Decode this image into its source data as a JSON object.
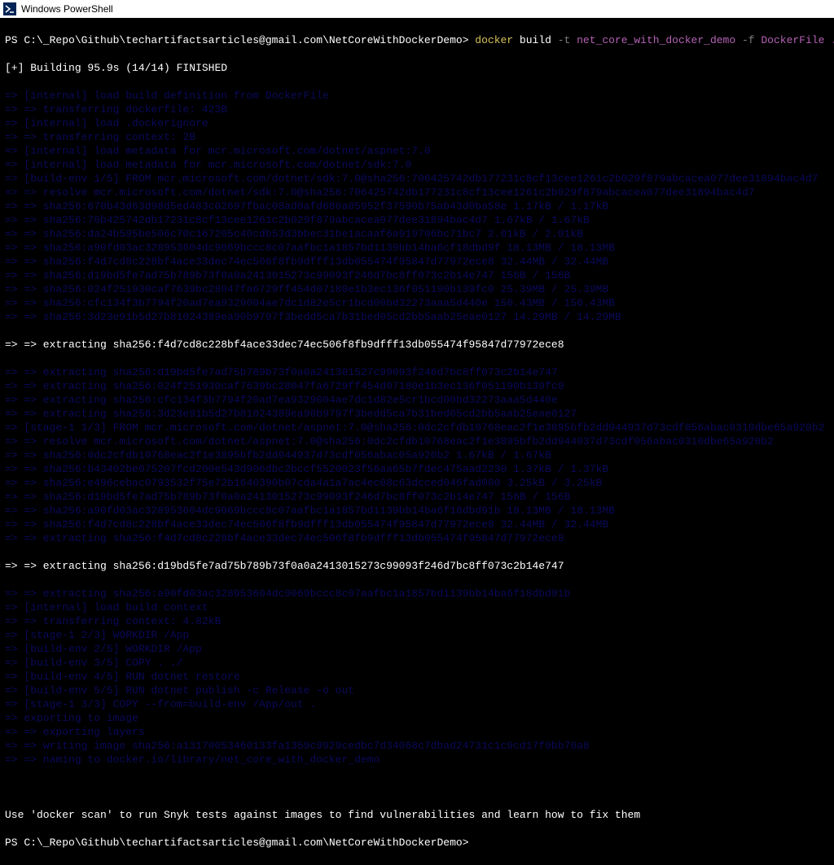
{
  "window": {
    "title": "Windows PowerShell"
  },
  "prompt": {
    "path1": "PS C:\\_Repo\\Github\\techartifactsarticles@gmail.com\\NetCoreWithDockerDemo> ",
    "cmd_docker": "docker",
    "cmd_build": " build ",
    "flag_t": "-t",
    "arg_name": " net_core_with_docker_demo ",
    "flag_f": "-f",
    "arg_file": " DockerFile .",
    "path2": "PS C:\\_Repo\\Github\\techartifactsarticles@gmail.com\\NetCoreWithDockerDemo>"
  },
  "build_header": "[+] Building 95.9s (14/14) FINISHED",
  "dim_lines_1": [
    "=> [internal] load build definition from DockerFile",
    "=> => transferring dockerfile: 423B",
    "=> [internal] load .dockerignore",
    "=> => transferring context: 2B",
    "=> [internal] load metadata for mcr.microsoft.com/dotnet/aspnet:7.0",
    "=> [internal] load metadata for mcr.microsoft.com/dotnet/sdk:7.0",
    "=> [build-env 1/5] FROM mcr.microsoft.com/dotnet/sdk:7.0@sha256:706425742db177231c8cf13cee1261c2b029f879abcacea077dee31894bac4d7",
    "=> => resolve mcr.microsoft.com/dotnet/sdk:7.0@sha256:706425742db177231c8cf13cee1261c2b029f879abcacea077dee31894bac4d7",
    "=> => sha256:670b43d63d98d5ed483c02697fbac08ad0afd680a05952f37590b75ab43d0ba58e 1.17kB / 1.17kB",
    "=> => sha256:70b425742db17231c8cf13cee1261c2b029f879abcacea077dee31894bac4d7 1.67kB / 1.67kB",
    "=> => sha256:da24b595be506c70c167205c40cdb53d3bbec31be1acaaf6a919706bc71bc7 2.01kB / 2.01kB",
    "=> => sha256:a90fd03ac328953604dc9069bccc8c07aafbc1a1857bd1139bb14ba6cf18dbd9f 18.13MB / 18.13MB",
    "=> => sha256:f4d7cd8c228bf4ace33dec74ec506f8fb9dfff13db055474f95847d77972ece8 32.44MB / 32.44MB",
    "=> => sha256:d19bd5fe7ad75b789b73f0a0a2413015273c99093f246d7bc8ff073c2b14e747 156B / 156B",
    "=> => sha256:024f251930caf7639bc28047fa6729ff454d07180e1b3ec136f051190b139fc0 25.39MB / 25.39MB",
    "=> => sha256:cfc134f3b7794f20ad7ea9329004ae7dc1d82e5cr1bcd00bd32273aaa5d440e 156.43MB / 156.43MB",
    "=> => sha256:3d23e91b5d27b81024389ea90b9797f3bedd5ca7b31bed05cd2bb5aab25eae0127 14.29MB / 14.29MB"
  ],
  "extract1": "=> => extracting sha256:f4d7cd8c228bf4ace33dec74ec506f8fb9dfff13db055474f95847d77972ece8",
  "dim_lines_2": [
    "=> => extracting sha256:d19bd5fe7ad75b789b73f0a0a241301527c99093f246d7bc8ff073c2b14e747",
    "=> => extracting sha256:024f251930caf7639bc28047fa6729ff454d07180e1b3ec136f051190b139fc0",
    "=> => extracting sha256:cfc134f3b7794f20ad7ea9329004ae7dc1d82e5cr1bcd00bd32273aaa5d440e",
    "=> => extracting sha256:3d23e91b5d27b81024389ea90b9797f3bedd5ca7b31bed05cd2bb5aab25eae0127",
    "=> [stage-1 1/3] FROM mcr.microsoft.com/dotnet/aspnet:7.0@sha256:0dc2cfdb10768eac2f1e3895bfb2dd944937d73cdf056abac0310dbe65a920b2",
    "=> => resolve mcr.microsoft.com/dotnet/aspnet:7.0@sha256:0dc2cfdb10768eac2f1e3895bfb2dd944937d73cdf056abac0310dbe65a920b2",
    "=> => sha256:0dc2cfdb10768eac2f1e3895bfb2dd944937d73cdf056abac05a920b2 1.67kB / 1.67kB",
    "=> => sha256:b43402be075207fcd200e543d906dbc2bccf5520023f56aa65b7fdec475aad2230 1.37kB / 1.37kB",
    "=> => sha256:e496cebac0793532f75e72b1640390b07cda4a1a7ac4ec08c63dcced046fad000 3.25kB / 3.25kB",
    "=> => sha256:d19bd5fe7ad75b789b73f0a0a2413015273c99093f246d7bc8ff073c2b14e747 156B / 156B",
    "=> => sha256:a90fd03ac328953604dc9069bccc8c07aafbc1a1857bd1139bb14ba6f18dbd91b 18.13MB / 18.13MB",
    "=> => sha256:f4d7cd8c228bf4ace33dec74ec506f8fb9dfff13db055474f95847d77972ece8 32.44MB / 32.44MB",
    "=> => extracting sha256:f4d7cd8c228bf4ace33dec74ec506f8fb9dfff13db055474f95847d77972ece8"
  ],
  "extract2": "=> => extracting sha256:d19bd5fe7ad75b789b73f0a0a2413015273c99093f246d7bc8ff073c2b14e747",
  "dim_lines_3": [
    "=> => extracting sha256:a90fd03ac328953604dc9069bccc8c07aafbc1a1857bd1139bb14ba6f18dbd91b",
    "=> [internal] load build context",
    "=> => transferring context: 4.82kB",
    "=> [stage-1 2/3] WORKDIR /App",
    "=> [build-env 2/5] WORKDIR /App",
    "=> [build-env 3/5] COPY . ./",
    "=> [build-env 4/5] RUN dotnet restore",
    "=> [build-env 5/5] RUN dotnet publish -c Release -o out",
    "=> [stage-1 3/3] COPY --from=build-env /App/out .",
    "=> exporting to image",
    "=> => exporting layers",
    "=> => writing image sha256:a13170053460133fa1359c9929cedbc7d34068c7dbad24731c1c9cd17f9bb70a8",
    "=> => naming to docker.io/library/net_core_with_docker_demo"
  ],
  "tip": "Use 'docker scan' to run Snyk tests against images to find vulnerabilities and learn how to fix them"
}
